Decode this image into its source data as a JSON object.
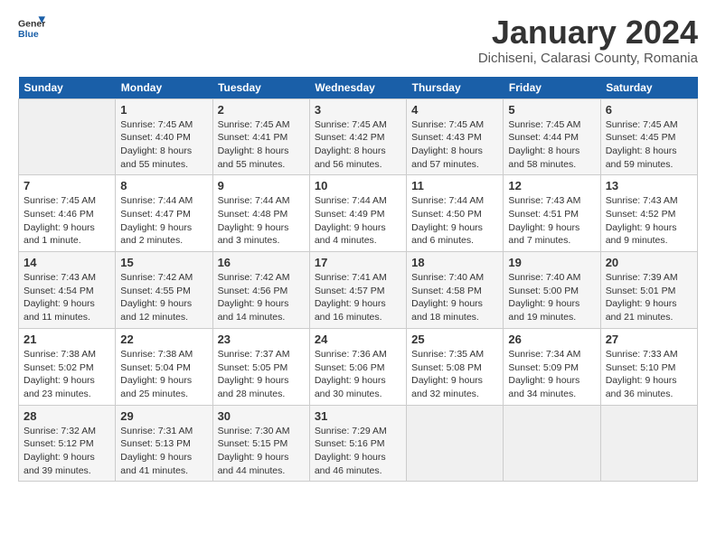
{
  "header": {
    "logo_general": "General",
    "logo_blue": "Blue",
    "title": "January 2024",
    "location": "Dichiseni, Calarasi County, Romania"
  },
  "days_of_week": [
    "Sunday",
    "Monday",
    "Tuesday",
    "Wednesday",
    "Thursday",
    "Friday",
    "Saturday"
  ],
  "weeks": [
    [
      {
        "day": "",
        "sunrise": "",
        "sunset": "",
        "daylight": ""
      },
      {
        "day": "1",
        "sunrise": "Sunrise: 7:45 AM",
        "sunset": "Sunset: 4:40 PM",
        "daylight": "Daylight: 8 hours and 55 minutes."
      },
      {
        "day": "2",
        "sunrise": "Sunrise: 7:45 AM",
        "sunset": "Sunset: 4:41 PM",
        "daylight": "Daylight: 8 hours and 55 minutes."
      },
      {
        "day": "3",
        "sunrise": "Sunrise: 7:45 AM",
        "sunset": "Sunset: 4:42 PM",
        "daylight": "Daylight: 8 hours and 56 minutes."
      },
      {
        "day": "4",
        "sunrise": "Sunrise: 7:45 AM",
        "sunset": "Sunset: 4:43 PM",
        "daylight": "Daylight: 8 hours and 57 minutes."
      },
      {
        "day": "5",
        "sunrise": "Sunrise: 7:45 AM",
        "sunset": "Sunset: 4:44 PM",
        "daylight": "Daylight: 8 hours and 58 minutes."
      },
      {
        "day": "6",
        "sunrise": "Sunrise: 7:45 AM",
        "sunset": "Sunset: 4:45 PM",
        "daylight": "Daylight: 8 hours and 59 minutes."
      }
    ],
    [
      {
        "day": "7",
        "sunrise": "Sunrise: 7:45 AM",
        "sunset": "Sunset: 4:46 PM",
        "daylight": "Daylight: 9 hours and 1 minute."
      },
      {
        "day": "8",
        "sunrise": "Sunrise: 7:44 AM",
        "sunset": "Sunset: 4:47 PM",
        "daylight": "Daylight: 9 hours and 2 minutes."
      },
      {
        "day": "9",
        "sunrise": "Sunrise: 7:44 AM",
        "sunset": "Sunset: 4:48 PM",
        "daylight": "Daylight: 9 hours and 3 minutes."
      },
      {
        "day": "10",
        "sunrise": "Sunrise: 7:44 AM",
        "sunset": "Sunset: 4:49 PM",
        "daylight": "Daylight: 9 hours and 4 minutes."
      },
      {
        "day": "11",
        "sunrise": "Sunrise: 7:44 AM",
        "sunset": "Sunset: 4:50 PM",
        "daylight": "Daylight: 9 hours and 6 minutes."
      },
      {
        "day": "12",
        "sunrise": "Sunrise: 7:43 AM",
        "sunset": "Sunset: 4:51 PM",
        "daylight": "Daylight: 9 hours and 7 minutes."
      },
      {
        "day": "13",
        "sunrise": "Sunrise: 7:43 AM",
        "sunset": "Sunset: 4:52 PM",
        "daylight": "Daylight: 9 hours and 9 minutes."
      }
    ],
    [
      {
        "day": "14",
        "sunrise": "Sunrise: 7:43 AM",
        "sunset": "Sunset: 4:54 PM",
        "daylight": "Daylight: 9 hours and 11 minutes."
      },
      {
        "day": "15",
        "sunrise": "Sunrise: 7:42 AM",
        "sunset": "Sunset: 4:55 PM",
        "daylight": "Daylight: 9 hours and 12 minutes."
      },
      {
        "day": "16",
        "sunrise": "Sunrise: 7:42 AM",
        "sunset": "Sunset: 4:56 PM",
        "daylight": "Daylight: 9 hours and 14 minutes."
      },
      {
        "day": "17",
        "sunrise": "Sunrise: 7:41 AM",
        "sunset": "Sunset: 4:57 PM",
        "daylight": "Daylight: 9 hours and 16 minutes."
      },
      {
        "day": "18",
        "sunrise": "Sunrise: 7:40 AM",
        "sunset": "Sunset: 4:58 PM",
        "daylight": "Daylight: 9 hours and 18 minutes."
      },
      {
        "day": "19",
        "sunrise": "Sunrise: 7:40 AM",
        "sunset": "Sunset: 5:00 PM",
        "daylight": "Daylight: 9 hours and 19 minutes."
      },
      {
        "day": "20",
        "sunrise": "Sunrise: 7:39 AM",
        "sunset": "Sunset: 5:01 PM",
        "daylight": "Daylight: 9 hours and 21 minutes."
      }
    ],
    [
      {
        "day": "21",
        "sunrise": "Sunrise: 7:38 AM",
        "sunset": "Sunset: 5:02 PM",
        "daylight": "Daylight: 9 hours and 23 minutes."
      },
      {
        "day": "22",
        "sunrise": "Sunrise: 7:38 AM",
        "sunset": "Sunset: 5:04 PM",
        "daylight": "Daylight: 9 hours and 25 minutes."
      },
      {
        "day": "23",
        "sunrise": "Sunrise: 7:37 AM",
        "sunset": "Sunset: 5:05 PM",
        "daylight": "Daylight: 9 hours and 28 minutes."
      },
      {
        "day": "24",
        "sunrise": "Sunrise: 7:36 AM",
        "sunset": "Sunset: 5:06 PM",
        "daylight": "Daylight: 9 hours and 30 minutes."
      },
      {
        "day": "25",
        "sunrise": "Sunrise: 7:35 AM",
        "sunset": "Sunset: 5:08 PM",
        "daylight": "Daylight: 9 hours and 32 minutes."
      },
      {
        "day": "26",
        "sunrise": "Sunrise: 7:34 AM",
        "sunset": "Sunset: 5:09 PM",
        "daylight": "Daylight: 9 hours and 34 minutes."
      },
      {
        "day": "27",
        "sunrise": "Sunrise: 7:33 AM",
        "sunset": "Sunset: 5:10 PM",
        "daylight": "Daylight: 9 hours and 36 minutes."
      }
    ],
    [
      {
        "day": "28",
        "sunrise": "Sunrise: 7:32 AM",
        "sunset": "Sunset: 5:12 PM",
        "daylight": "Daylight: 9 hours and 39 minutes."
      },
      {
        "day": "29",
        "sunrise": "Sunrise: 7:31 AM",
        "sunset": "Sunset: 5:13 PM",
        "daylight": "Daylight: 9 hours and 41 minutes."
      },
      {
        "day": "30",
        "sunrise": "Sunrise: 7:30 AM",
        "sunset": "Sunset: 5:15 PM",
        "daylight": "Daylight: 9 hours and 44 minutes."
      },
      {
        "day": "31",
        "sunrise": "Sunrise: 7:29 AM",
        "sunset": "Sunset: 5:16 PM",
        "daylight": "Daylight: 9 hours and 46 minutes."
      },
      {
        "day": "",
        "sunrise": "",
        "sunset": "",
        "daylight": ""
      },
      {
        "day": "",
        "sunrise": "",
        "sunset": "",
        "daylight": ""
      },
      {
        "day": "",
        "sunrise": "",
        "sunset": "",
        "daylight": ""
      }
    ]
  ]
}
